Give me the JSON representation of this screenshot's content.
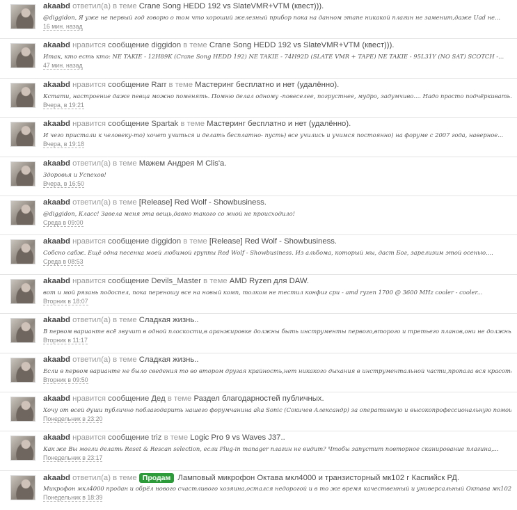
{
  "feed": {
    "items": [
      {
        "user": "akaabd",
        "action": "ответил(а)",
        "target": "",
        "in_label": "в теме",
        "tag": "",
        "topic": "Crane Song HEDD 192 vs SlateVMR+VTM (квест))).",
        "snippet": "@diggidon, Я уже не первый год говорю о том что хороший железный прибор пока на данном этапе никакой плагин не заменит,даже Uad не...",
        "time": "16 мин. назад"
      },
      {
        "user": "akaabd",
        "action": "нравится",
        "target": "сообщение diggidon",
        "in_label": "в теме",
        "tag": "",
        "topic": "Crane Song HEDD 192 vs SlateVMR+VTM (квест))).",
        "snippet": "Итак, кто есть кто: NE TAKIE - 12H89K (Crane Song HEDD 192) NE TAKIE - 74H92D (SLATE VMR + TAPE) NE TAKIE - 95L31Y (NO SAT) SCOTCH -...",
        "time": "47 мин. назад"
      },
      {
        "user": "akaabd",
        "action": "нравится",
        "target": "сообщение Rarr",
        "in_label": "в теме",
        "tag": "",
        "topic": "Мастеринг бесплатно и нет (удалённо).",
        "snippet": "Кстати, настроение даже певца можно поменять. Помню делал одному -повеселее, погрустнее, мудро, задумчиво.... Надо просто подчёркивать...",
        "time": "Вчера, в 19:21"
      },
      {
        "user": "akaabd",
        "action": "нравится",
        "target": "сообщение Spartak",
        "in_label": "в теме",
        "tag": "",
        "topic": "Мастеринг бесплатно и нет (удалённо).",
        "snippet": "И чего пристали к человеку-то) хочет учиться и делать бесплатно- пусть) все учились и учимся постоянно) на форуме с 2007 года, наверное...",
        "time": "Вчера, в 19:18"
      },
      {
        "user": "akaabd",
        "action": "ответил(а)",
        "target": "",
        "in_label": "в теме",
        "tag": "",
        "topic": "Мажем Андрея М Clis'a.",
        "snippet": "Здоровья и Успехов!",
        "time": "Вчера, в 16:50"
      },
      {
        "user": "akaabd",
        "action": "ответил(а)",
        "target": "",
        "in_label": "в теме",
        "tag": "",
        "topic": "[Release] Red Wolf - Showbusiness.",
        "snippet": "@diggidon, Класс! Завела меня эта вещь,давно такого со мной не происходило!",
        "time": "Среда в 09:00"
      },
      {
        "user": "akaabd",
        "action": "нравится",
        "target": "сообщение diggidon",
        "in_label": "в теме",
        "tag": "",
        "topic": "[Release] Red Wolf - Showbusiness.",
        "snippet": "Собсно сабж. Ещё одна песенка моей любимой группы Red Wolf - Showbusiness. Из альбома, который мы, даст Бог, зарелизим этой осенью....",
        "time": "Среда в 08:53"
      },
      {
        "user": "akaabd",
        "action": "нравится",
        "target": "сообщение Devils_Master",
        "in_label": "в теме",
        "tag": "",
        "topic": "AMD Ryzen для DAW.",
        "snippet": "вот и мой рязань подоспел, пока переношу все на новый комп, толком не тестил конфиг cpu - amd ryzen 1700 @ 3600 MHz cooler - cooler...",
        "time": "Вторник в 18:07"
      },
      {
        "user": "akaabd",
        "action": "ответил(а)",
        "target": "",
        "in_label": "в теме",
        "tag": "",
        "topic": "Сладкая жизнь..",
        "snippet": "В первом варианте всё звучит в одной плоскости,в аранжировке должны быть инструменты первого,второго и третьего планов,они не должны...",
        "time": "Вторник в 11:17"
      },
      {
        "user": "akaabd",
        "action": "ответил(а)",
        "target": "",
        "in_label": "в теме",
        "tag": "",
        "topic": "Сладкая жизнь..",
        "snippet": "Если в первом варианте не было сведения то во втором другая крайность,нет никакого дыхания в инструментальной части,пропала вся красота...",
        "time": "Вторник в 09:50"
      },
      {
        "user": "akaabd",
        "action": "нравится",
        "target": "сообщение Дед",
        "in_label": "в теме",
        "tag": "",
        "topic": "Раздел благодарностей публичных.",
        "snippet": "Хочу от всей души публично поблагодарить нашего форумчанина aka Sonic (Сокичев Александр) за оперативную и высокопрофессиональную помощь...",
        "time": "Понедельник в 23:20"
      },
      {
        "user": "akaabd",
        "action": "нравится",
        "target": "сообщение triz",
        "in_label": "в теме",
        "tag": "",
        "topic": "Logic Pro 9 vs Waves J37..",
        "snippet": "Как же Вы могли делать Reset & Rescan selection, если Plug-in manager плагин не видит? Чтобы запустит повторное сканирование плагина,...",
        "time": "Понедельник в 23:17"
      },
      {
        "user": "akaabd",
        "action": "ответил(а)",
        "target": "",
        "in_label": "в теме",
        "tag": "Продам",
        "topic": "Ламповый микрофон Октава мкл4000 и транзисторный мк102 г Каспийск РД.",
        "snippet": "Микрофон мкл4000 продан и обрёл нового счастливого хозяина,остался недорогой и в то же время качественный и универсальный Октава мк102",
        "time": "Понедельник в 18:39"
      }
    ]
  }
}
